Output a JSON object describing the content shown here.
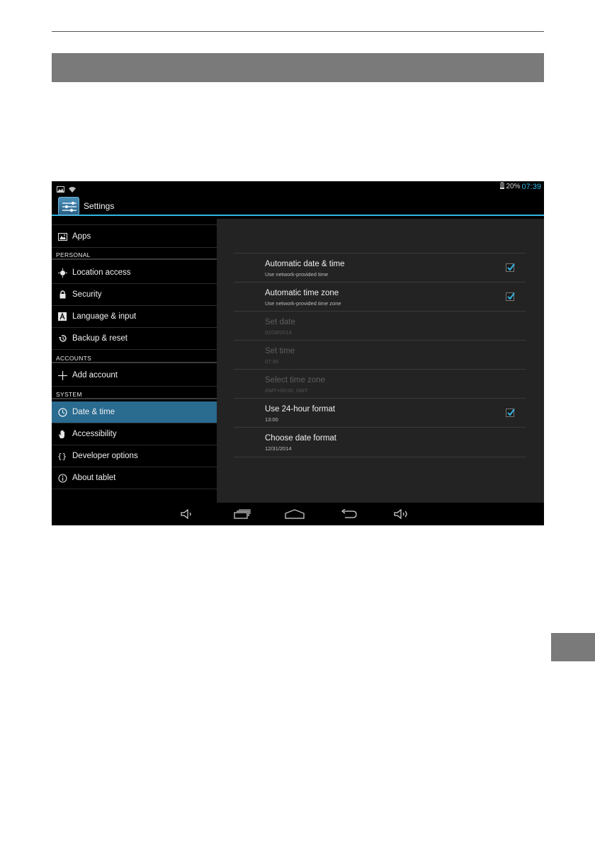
{
  "status_bar": {
    "battery_percent": "20%",
    "time": "07:39"
  },
  "action_bar": {
    "title": "Settings",
    "icon": "settings-sliders-icon"
  },
  "sidebar": {
    "items": [
      {
        "label": "Apps",
        "icon": "apps-icon"
      },
      {
        "header": "PERSONAL"
      },
      {
        "label": "Location access",
        "icon": "location-icon"
      },
      {
        "label": "Security",
        "icon": "lock-icon"
      },
      {
        "label": "Language & input",
        "icon": "language-icon"
      },
      {
        "label": "Backup & reset",
        "icon": "backup-icon"
      },
      {
        "header": "ACCOUNTS"
      },
      {
        "label": "Add account",
        "icon": "plus-icon"
      },
      {
        "header": "SYSTEM"
      },
      {
        "label": "Date & time",
        "icon": "clock-icon",
        "selected": true
      },
      {
        "label": "Accessibility",
        "icon": "hand-icon"
      },
      {
        "label": "Developer options",
        "icon": "braces-icon"
      },
      {
        "label": "About tablet",
        "icon": "info-icon"
      }
    ]
  },
  "date_time": {
    "items": [
      {
        "title": "Automatic date & time",
        "summary": "Use network-provided time",
        "checked": true,
        "enabled": true
      },
      {
        "title": "Automatic time zone",
        "summary": "Use network-provided time zone",
        "checked": true,
        "enabled": true
      },
      {
        "title": "Set date",
        "summary": "02/28/2014",
        "enabled": false
      },
      {
        "title": "Set time",
        "summary": "07:39",
        "enabled": false
      },
      {
        "title": "Select time zone",
        "summary": "GMT+00:00, GMT",
        "enabled": false
      },
      {
        "title": "Use 24-hour format",
        "summary": "13:00",
        "checked": true,
        "enabled": true
      },
      {
        "title": "Choose date format",
        "summary": "12/31/2014",
        "enabled": true
      }
    ]
  },
  "nav_bar": {
    "buttons": [
      "volume-down-icon",
      "recent-apps-icon",
      "home-icon",
      "back-icon",
      "volume-up-icon"
    ]
  },
  "colors": {
    "accent": "#33b5e5",
    "selected_row": "#2a6b90",
    "pane": "#232323"
  }
}
